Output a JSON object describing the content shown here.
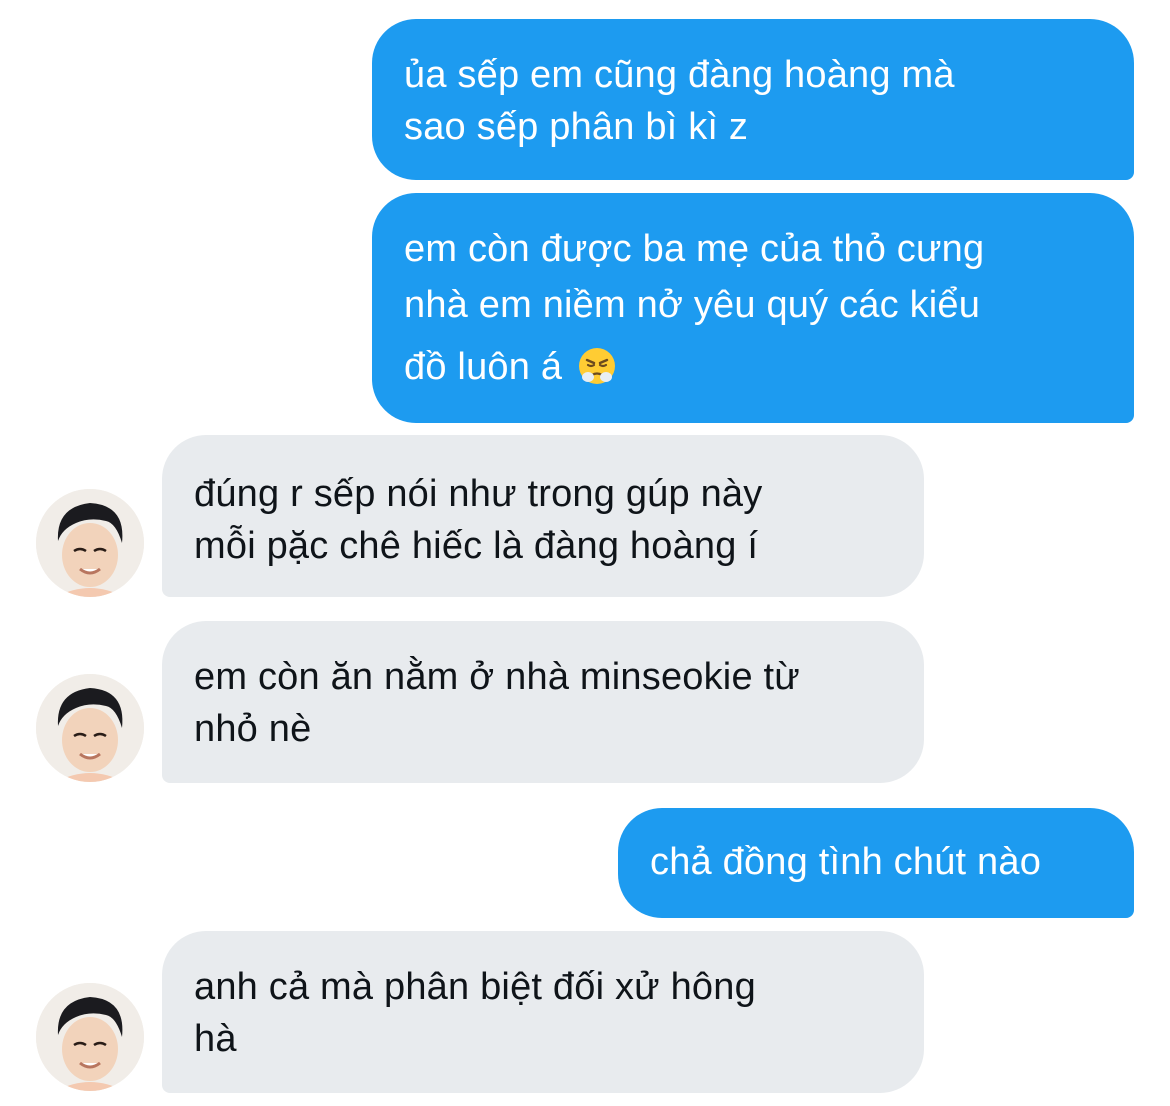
{
  "conversation": {
    "messages": [
      {
        "direction": "outgoing",
        "lines": [
          "ủa sếp em cũng đàng hoàng mà",
          "sao sếp phân bì kì z"
        ]
      },
      {
        "direction": "outgoing",
        "lines": [
          "em còn được ba mẹ của thỏ cưng",
          "nhà em niềm nở yêu quý các kiểu",
          "đồ luôn á"
        ],
        "trailing_emoji": "steam-from-nose-emoji"
      },
      {
        "direction": "incoming",
        "lines": [
          "đúng r sếp nói như trong gúp này",
          "mỗi pặc chê hiếc là đàng hoàng í"
        ],
        "avatar": "user-avatar-photo"
      },
      {
        "direction": "incoming",
        "lines": [
          "em còn ăn nằm ở nhà minseokie từ",
          "nhỏ nè"
        ],
        "avatar": "user-avatar-photo"
      },
      {
        "direction": "outgoing",
        "lines": [
          "chả đồng tình chút nào"
        ]
      },
      {
        "direction": "incoming",
        "lines": [
          "anh cả mà phân biệt đối xử hông",
          "hà"
        ],
        "avatar": "user-avatar-photo"
      }
    ]
  },
  "colors": {
    "outgoing_bubble": "#1d9bf0",
    "incoming_bubble": "#e8ebee",
    "outgoing_text": "#ffffff",
    "incoming_text": "#0f1419"
  }
}
